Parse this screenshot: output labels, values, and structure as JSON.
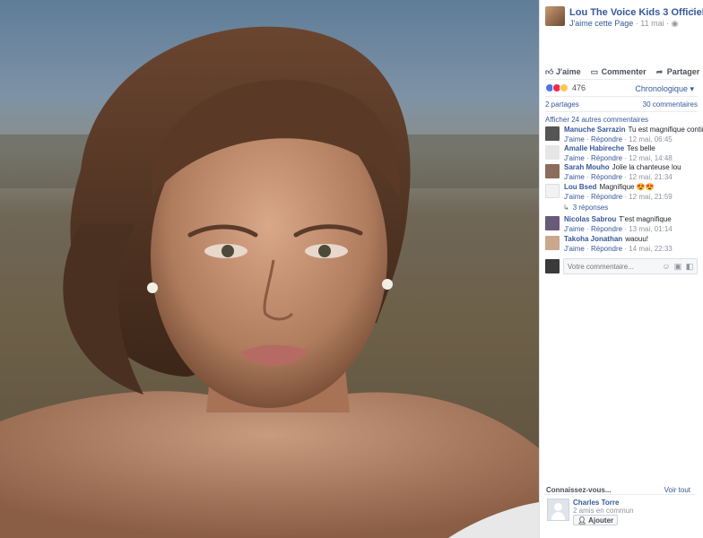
{
  "page": {
    "name": "Lou The Voice Kids 3 Officiel",
    "like_page": "J'aime cette Page",
    "date": "11 mai",
    "close_icon": "close-icon"
  },
  "actions": {
    "like": "J'aime",
    "comment": "Commenter",
    "share": "Partager"
  },
  "reactions": {
    "count": "476",
    "icons": [
      "like-icon",
      "love-icon",
      "wow-icon"
    ],
    "colors": {
      "like": "#4a76e8",
      "love": "#f0284a",
      "wow": "#f7c94b"
    },
    "sort": "Chronologique"
  },
  "stats": {
    "shares": "2 partages",
    "comments": "30 commentaires"
  },
  "more_comments": "Afficher 24 autres commentaires",
  "reply_label": "Répondre",
  "like_label": "J'aime",
  "comments": [
    {
      "author": "Manuche Sarrazin",
      "text": "Tu est magnifique continue",
      "time": "12 mai, 06:45",
      "avatar_color": "#555555"
    },
    {
      "author": "Amalle Habireche",
      "text": "Tes belle",
      "time": "12 mai, 14:48",
      "avatar_color": "#e6e6e6"
    },
    {
      "author": "Sarah Mouho",
      "text": "Jolie la chanteuse lou",
      "time": "12 mai, 21:34",
      "avatar_color": "#8a6d5a"
    },
    {
      "author": "Lou Bsed",
      "text": "Magnifique 😍😍",
      "time": "12 mai, 21:59",
      "avatar_color": "#f2f2f2"
    },
    {
      "author": "Nicolas Sabrou",
      "text": "T'est magnifique",
      "time": "13 mai, 01:14",
      "avatar_color": "#6a5a7a"
    },
    {
      "author": "Takoha Jonathan",
      "text": "waouu!",
      "time": "14 mai, 22:33",
      "avatar_color": "#c9a88e"
    }
  ],
  "replies": "3 réponses",
  "write_comment": {
    "placeholder": "Votre commentaire..."
  },
  "people": {
    "title": "Connaissez-vous...",
    "see_all": "Voir tout",
    "name": "Charles Torre",
    "mutual": "2 amis en commun",
    "add": "Ajouter"
  }
}
